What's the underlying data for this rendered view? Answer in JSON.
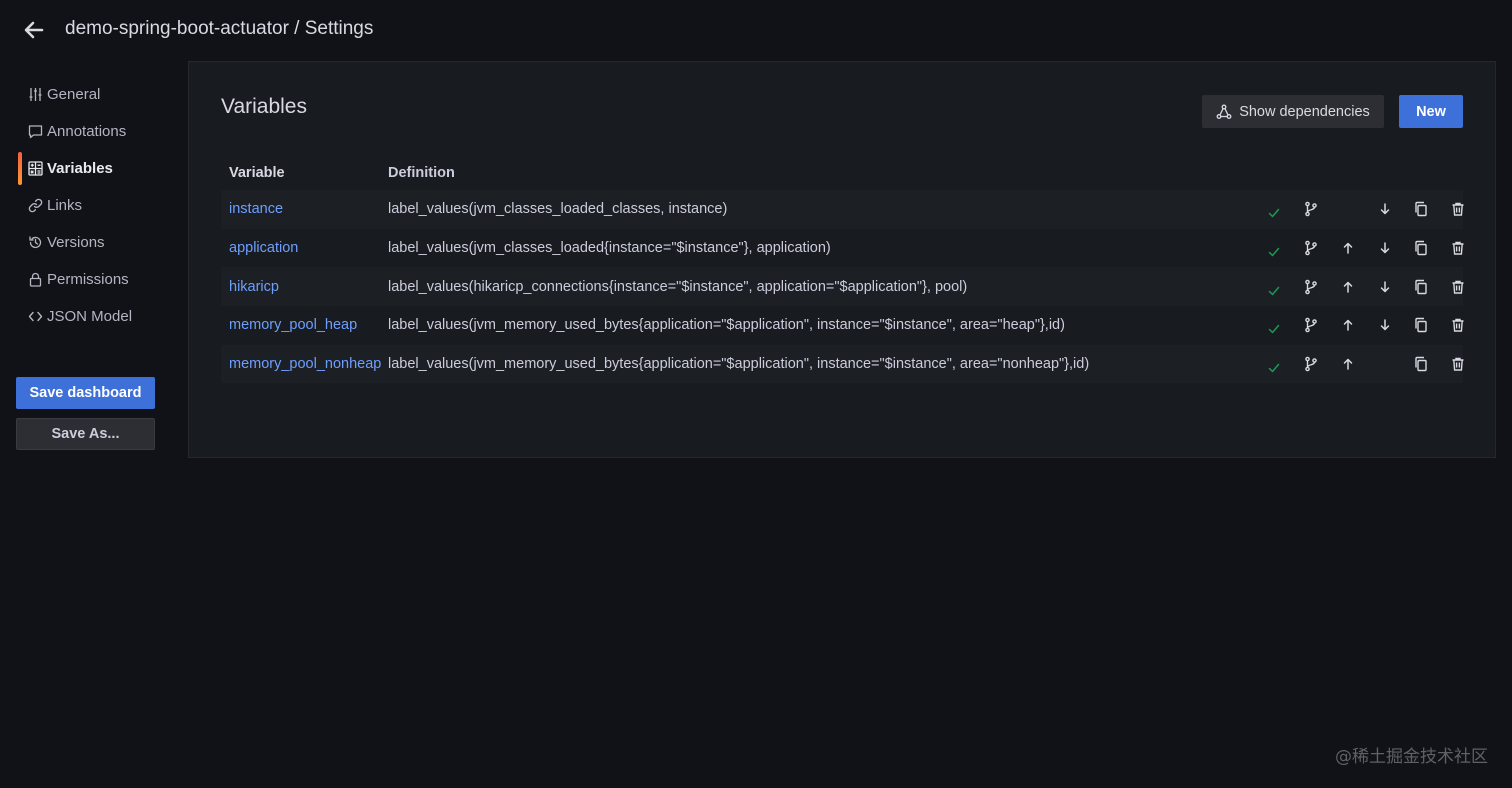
{
  "header": {
    "title": "demo-spring-boot-actuator / Settings",
    "back_icon": "arrow-left-icon"
  },
  "sidebar": {
    "items": [
      {
        "label": "General",
        "icon": "sliders-icon",
        "active": false
      },
      {
        "label": "Annotations",
        "icon": "comment-icon",
        "active": false
      },
      {
        "label": "Variables",
        "icon": "calculator-icon",
        "active": true
      },
      {
        "label": "Links",
        "icon": "link-icon",
        "active": false
      },
      {
        "label": "Versions",
        "icon": "history-icon",
        "active": false
      },
      {
        "label": "Permissions",
        "icon": "lock-icon",
        "active": false
      },
      {
        "label": "JSON Model",
        "icon": "code-icon",
        "active": false
      }
    ],
    "save_label": "Save dashboard",
    "save_as_label": "Save As..."
  },
  "main": {
    "title": "Variables",
    "show_dependencies_label": "Show dependencies",
    "new_label": "New",
    "columns": [
      "Variable",
      "Definition"
    ],
    "rows": [
      {
        "name": "instance",
        "definition": "label_values(jvm_classes_loaded_classes, instance)",
        "can_move_up": false,
        "can_move_down": true
      },
      {
        "name": "application",
        "definition": "label_values(jvm_classes_loaded{instance=\"$instance\"}, application)",
        "can_move_up": true,
        "can_move_down": true
      },
      {
        "name": "hikaricp",
        "definition": "label_values(hikaricp_connections{instance=\"$instance\", application=\"$application\"}, pool)",
        "can_move_up": true,
        "can_move_down": true
      },
      {
        "name": "memory_pool_heap",
        "definition": "label_values(jvm_memory_used_bytes{application=\"$application\", instance=\"$instance\", area=\"heap\"},id)",
        "can_move_up": true,
        "can_move_down": true
      },
      {
        "name": "memory_pool_nonheap",
        "definition": "label_values(jvm_memory_used_bytes{application=\"$application\", instance=\"$instance\", area=\"nonheap\"},id)",
        "can_move_up": true,
        "can_move_down": false
      }
    ]
  },
  "watermark": "@稀土掘金技术社区",
  "colors": {
    "background": "#111217",
    "panel": "#181b1f",
    "primary": "#3d71d9",
    "link": "#6e9fff",
    "success": "#1a7f4b",
    "active_bar": "#ff7a30"
  }
}
